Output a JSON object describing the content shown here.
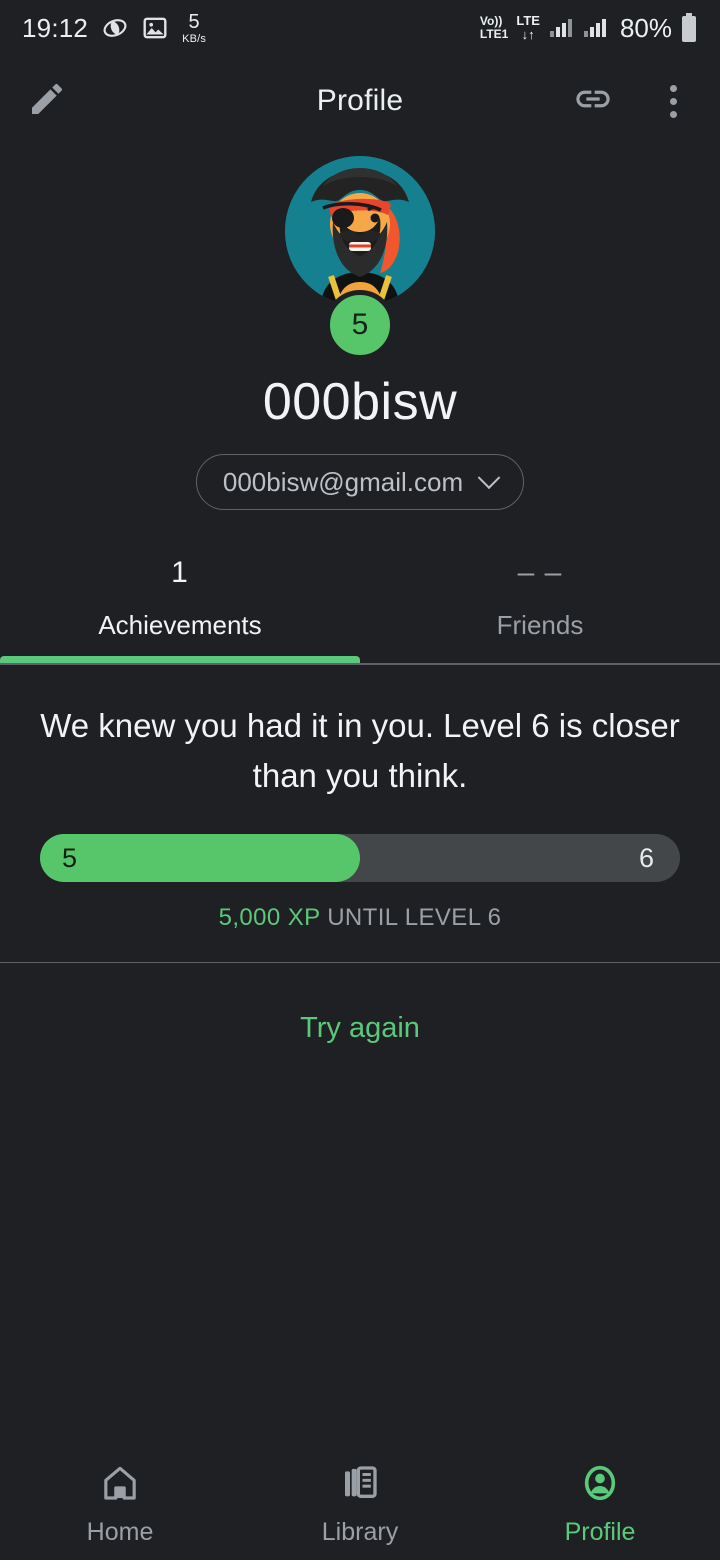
{
  "statusbar": {
    "time": "19:12",
    "net_speed_value": "5",
    "net_speed_unit": "KB/s",
    "volte_top": "Vo))",
    "volte_bottom": "LTE1",
    "lte_label": "LTE",
    "lte_arrows": "↓↑",
    "battery": "80%",
    "icons": [
      "opera-icon",
      "image-icon",
      "signal-icon",
      "signal-icon",
      "battery-icon"
    ]
  },
  "appbar": {
    "title": "Profile",
    "edit_icon": "pencil-icon",
    "link_icon": "link-icon",
    "more_icon": "overflow-menu-icon"
  },
  "profile": {
    "avatar_alt": "pirate-avatar",
    "level_badge": "5",
    "username": "000bisw",
    "email": "000bisw@gmail.com",
    "chevron_icon": "chevron-down-icon"
  },
  "tabs": [
    {
      "count": "1",
      "label": "Achievements",
      "active": true
    },
    {
      "count": "– –",
      "label": "Friends",
      "active": false
    }
  ],
  "level_card": {
    "message": "We knew you had it in you. Level 6 is closer than you think.",
    "current_level": "5",
    "next_level": "6",
    "progress_percent": 50,
    "xp_amount": "5,000 XP",
    "xp_rest": "UNTIL LEVEL 6"
  },
  "error_state": {
    "retry_label": "Try again"
  },
  "bottomnav": [
    {
      "label": "Home",
      "icon": "home-icon",
      "active": false
    },
    {
      "label": "Library",
      "icon": "library-icon",
      "active": false
    },
    {
      "label": "Profile",
      "icon": "profile-icon",
      "active": true
    }
  ],
  "colors": {
    "background": "#1e2023",
    "accent_green": "#5bc97a",
    "progress_green": "#57c66a",
    "track_gray": "#44474a",
    "text_primary": "#f1f3f4",
    "text_secondary": "#9aa0a6",
    "avatar_bg": "#15808f"
  }
}
